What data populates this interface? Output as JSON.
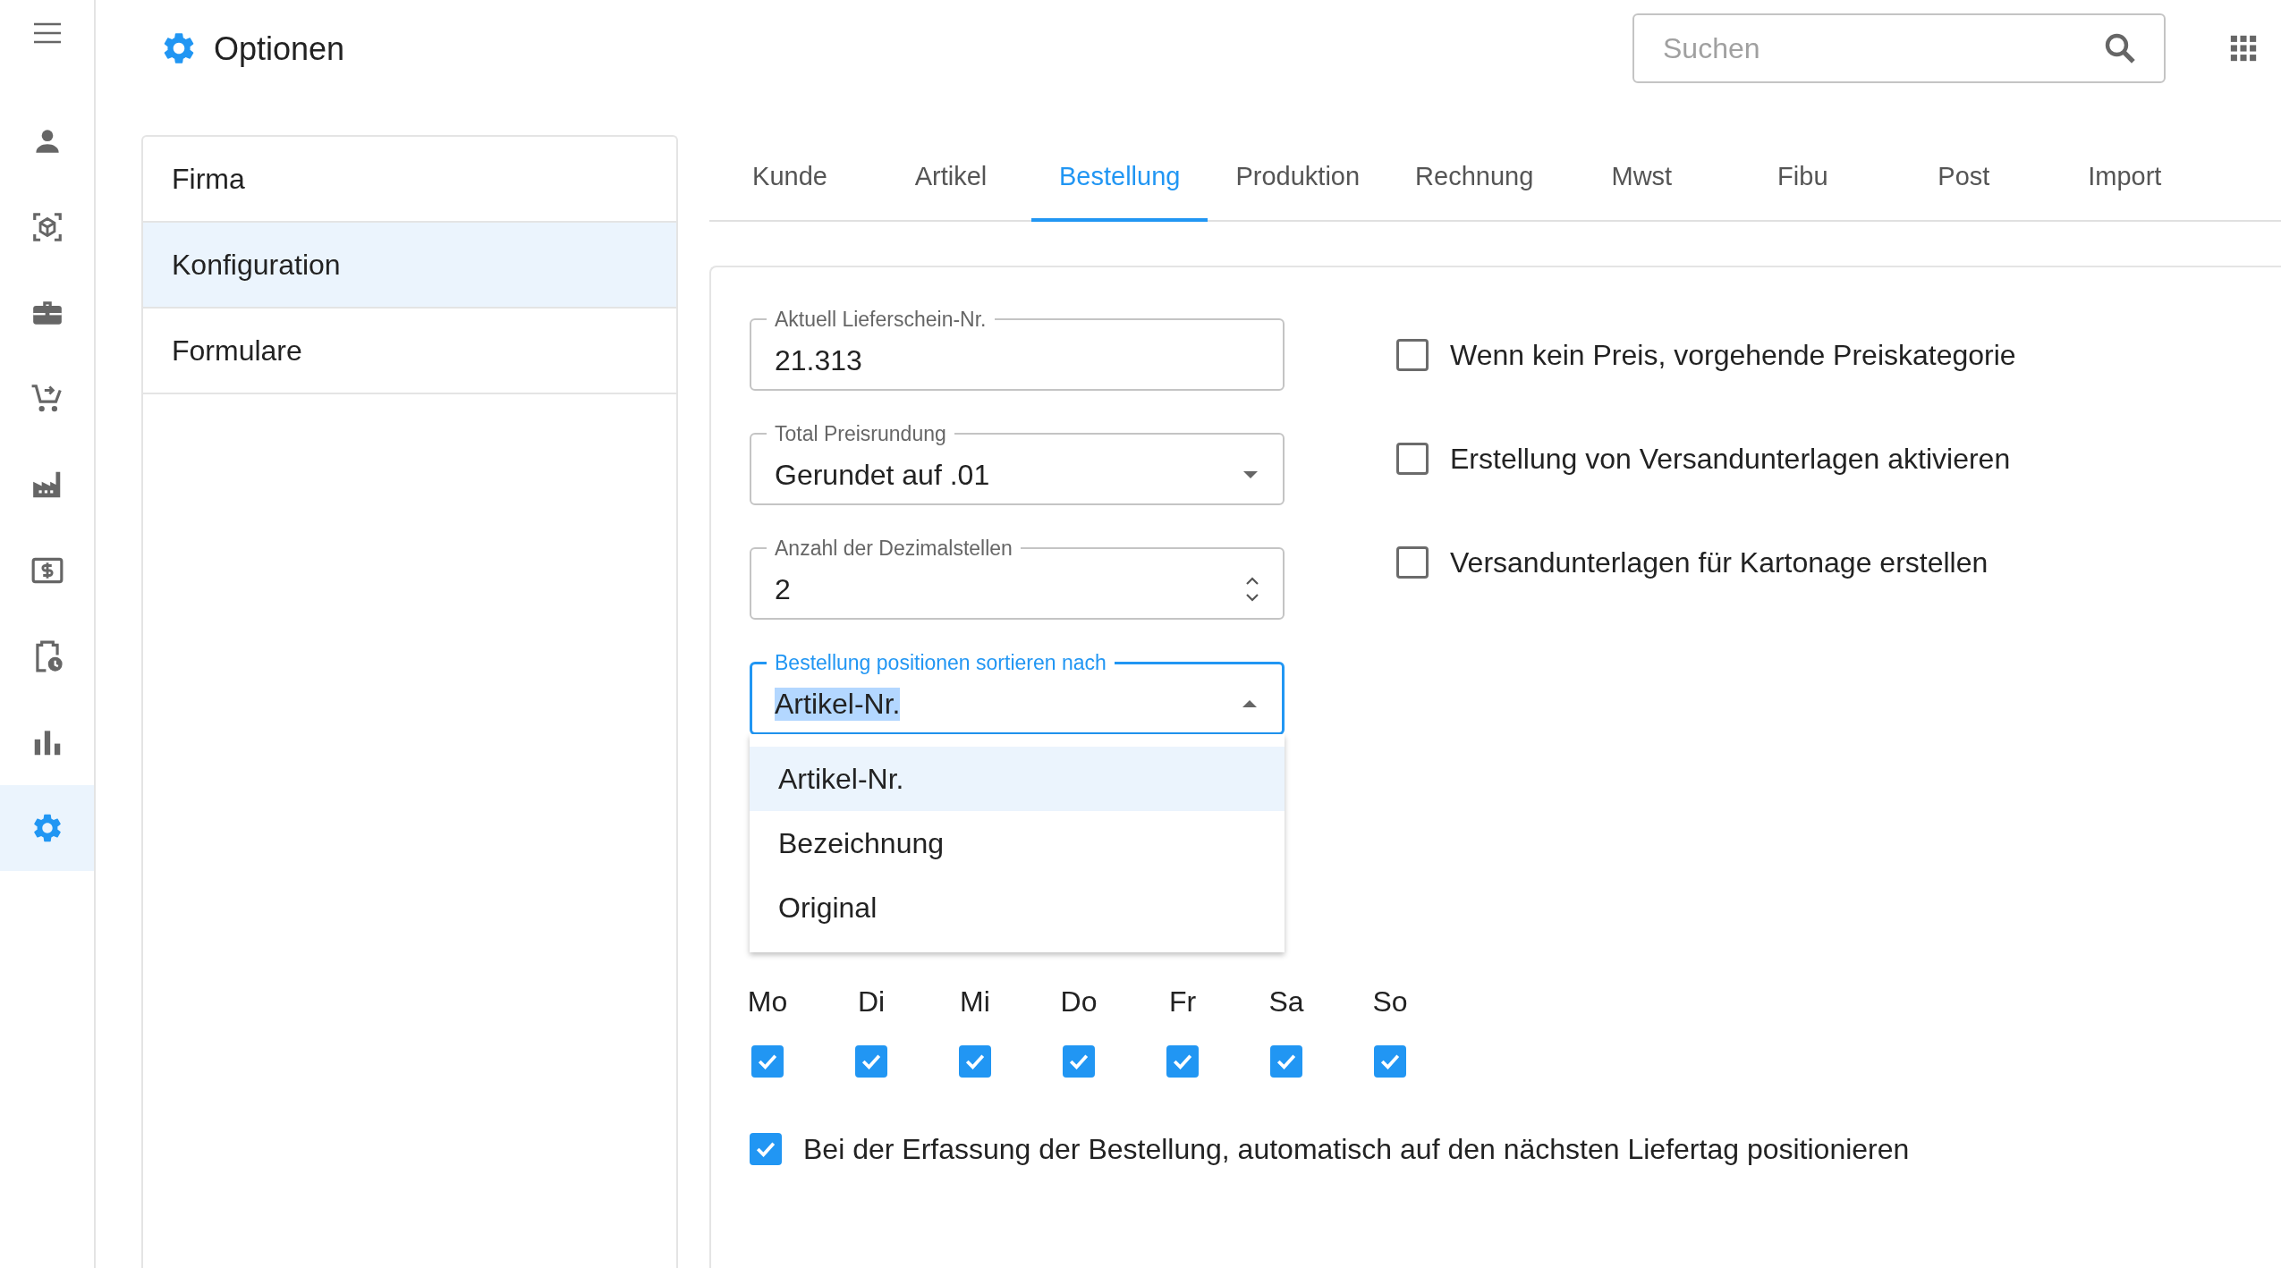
{
  "header": {
    "title": "Optionen",
    "search": {
      "placeholder": "Suchen"
    }
  },
  "nav": [
    {
      "selected": false
    },
    {
      "selected": false
    },
    {
      "selected": false
    },
    {
      "selected": false
    },
    {
      "selected": false
    },
    {
      "selected": false
    },
    {
      "selected": false
    },
    {
      "selected": false
    },
    {
      "selected": true
    }
  ],
  "sections": [
    {
      "label": "Firma",
      "selected": false
    },
    {
      "label": "Konfiguration",
      "selected": true
    },
    {
      "label": "Formulare",
      "selected": false
    }
  ],
  "tabs": [
    {
      "label": "Kunde",
      "selected": false
    },
    {
      "label": "Artikel",
      "selected": false
    },
    {
      "label": "Bestellung",
      "selected": true
    },
    {
      "label": "Produktion",
      "selected": false
    },
    {
      "label": "Rechnung",
      "selected": false
    },
    {
      "label": "Mwst",
      "selected": false
    },
    {
      "label": "Fibu",
      "selected": false
    },
    {
      "label": "Post",
      "selected": false
    },
    {
      "label": "Import",
      "selected": false
    }
  ],
  "fields": [
    {
      "kind": "text",
      "label": "Aktuell Lieferschein-Nr.",
      "value": "21.313"
    },
    {
      "kind": "select",
      "label": "Total Preisrundung",
      "value": "Gerundet auf .01",
      "expanded": false
    },
    {
      "kind": "number",
      "label": "Anzahl der Dezimalstellen",
      "value": "2"
    },
    {
      "kind": "select",
      "label": "Bestellung positionen sortieren nach",
      "value": "Artikel-Nr.",
      "expanded": true,
      "options": [
        {
          "label": "Artikel-Nr.",
          "selected": true
        },
        {
          "label": "Bezeichnung",
          "selected": false
        },
        {
          "label": "Original",
          "selected": false
        }
      ]
    }
  ],
  "checks": [
    {
      "label": "Wenn kein Preis, vorgehende Preiskategorie",
      "checked": false
    },
    {
      "label": "Erstellung von Versandunterlagen aktivieren",
      "checked": false
    },
    {
      "label": "Versandunterlagen für Kartonage erstellen",
      "checked": false
    }
  ],
  "days": [
    {
      "label": "Mo",
      "checked": true
    },
    {
      "label": "Di",
      "checked": true
    },
    {
      "label": "Mi",
      "checked": true
    },
    {
      "label": "Do",
      "checked": true
    },
    {
      "label": "Fr",
      "checked": true
    },
    {
      "label": "Sa",
      "checked": true
    },
    {
      "label": "So",
      "checked": true
    }
  ],
  "auto_position": {
    "label": "Bei der Erfassung der Bestellung, automatisch auf den nächsten Liefertag positionieren",
    "checked": true
  }
}
